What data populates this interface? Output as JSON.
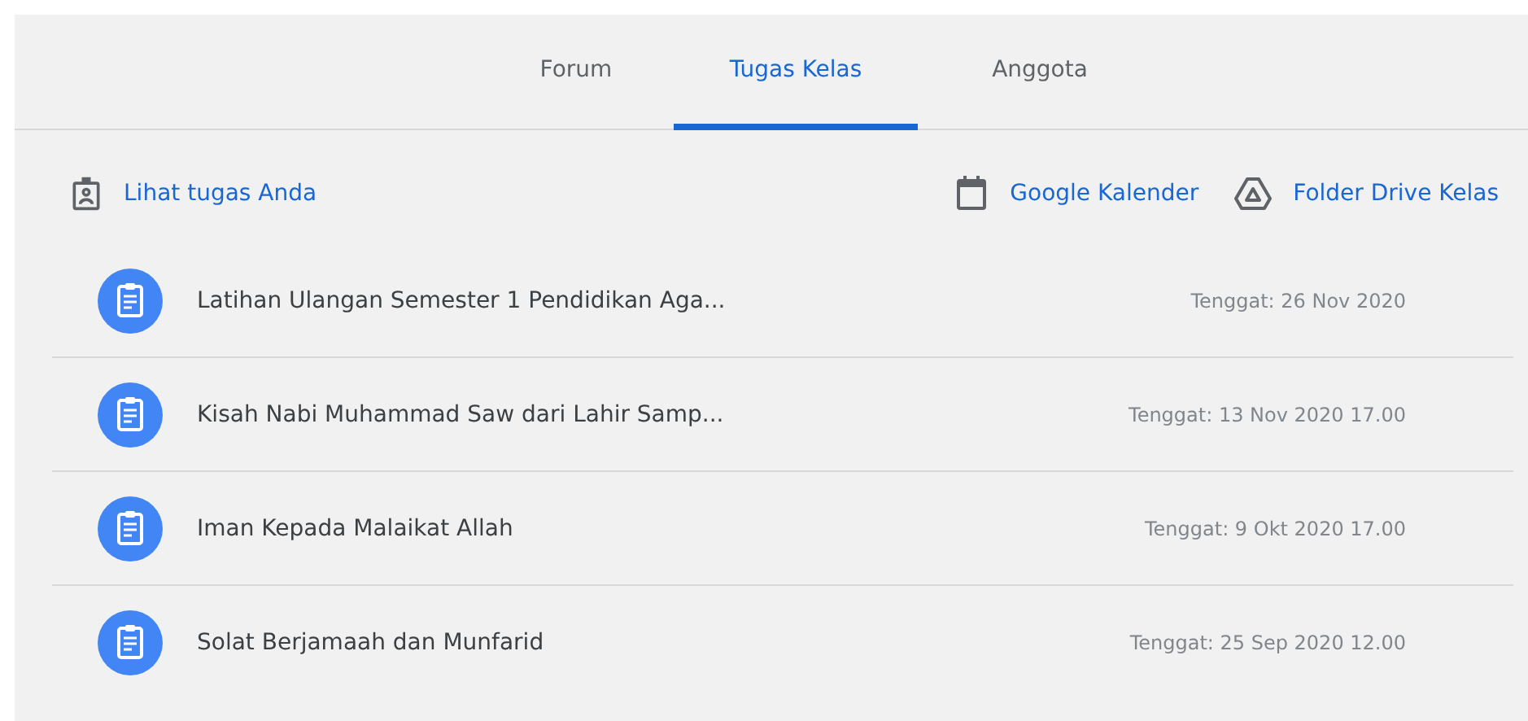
{
  "tabs": [
    {
      "label": "Forum",
      "selected": false
    },
    {
      "label": "Tugas Kelas",
      "selected": true
    },
    {
      "label": "Anggota",
      "selected": false
    }
  ],
  "actions": {
    "left": [
      {
        "kind": "profile",
        "label": "Lihat tugas Anda"
      }
    ],
    "right": [
      {
        "kind": "calendar",
        "label": "Google Kalender"
      },
      {
        "kind": "drive",
        "label": "Folder Drive Kelas"
      }
    ]
  },
  "assignments": [
    {
      "title": "Latihan Ulangan Semester 1 Pendidikan Aga...",
      "due": "Tenggat: 26 Nov 2020"
    },
    {
      "title": "Kisah Nabi Muhammad Saw dari Lahir Samp...",
      "due": "Tenggat: 13 Nov 2020 17.00"
    },
    {
      "title": "Iman Kepada Malaikat Allah",
      "due": "Tenggat: 9 Okt 2020 17.00"
    },
    {
      "title": "Solat Berjamaah dan Munfarid",
      "due": "Tenggat: 25 Sep 2020 12.00"
    }
  ]
}
